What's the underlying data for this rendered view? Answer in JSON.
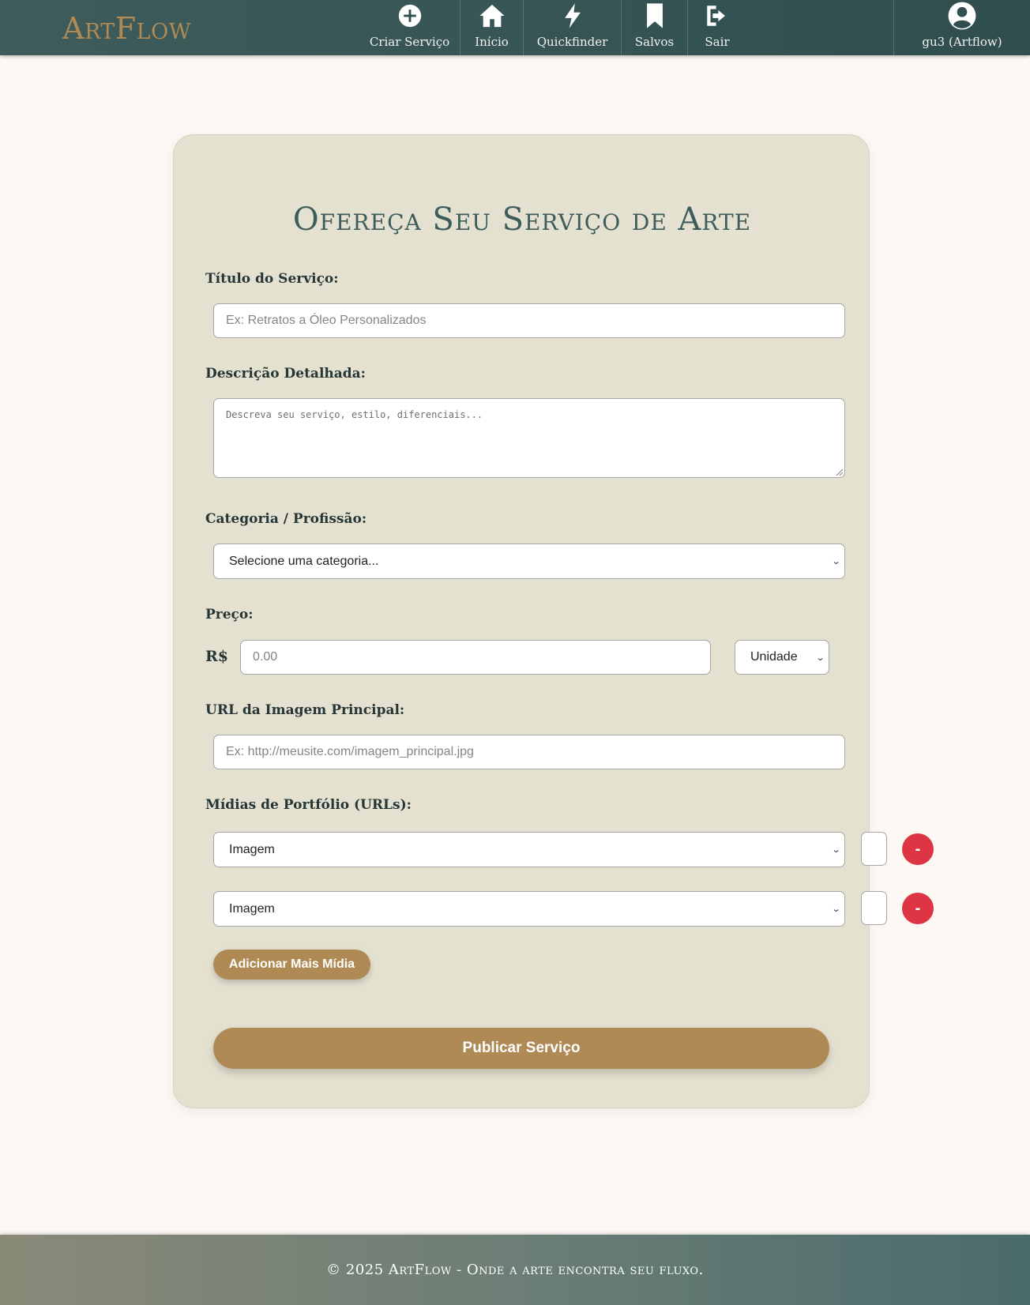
{
  "brand": {
    "logo": "ArtFlow",
    "accent_color": "#b08a55",
    "primary_color": "#3e5c5b"
  },
  "nav": {
    "items": [
      {
        "label": "Criar Serviço",
        "icon": "plus-circle-icon"
      },
      {
        "label": "Início",
        "icon": "home-icon"
      },
      {
        "label": "Quickfinder",
        "icon": "bolt-icon"
      },
      {
        "label": "Salvos",
        "icon": "bookmark-icon"
      },
      {
        "label": "Sair",
        "icon": "logout-icon"
      }
    ],
    "user": {
      "label": "gu3 (Artflow)",
      "icon": "user-circle-icon"
    }
  },
  "form": {
    "title": "Ofereça Seu Serviço de Arte",
    "titulo": {
      "label": "Título do Serviço:",
      "placeholder": "Ex: Retratos a Óleo Personalizados"
    },
    "descricao": {
      "label": "Descrição Detalhada:",
      "placeholder": "Descreva seu serviço, estilo, diferenciais..."
    },
    "categoria": {
      "label": "Categoria / Profissão:",
      "selected": "Selecione uma categoria..."
    },
    "preco": {
      "label": "Preço:",
      "currency": "R$",
      "placeholder": "0.00",
      "unit_selected": "Unidade"
    },
    "imagem_principal": {
      "label": "URL da Imagem Principal:",
      "placeholder": "Ex: http://meusite.com/imagem_principal.jpg"
    },
    "midias": {
      "label": "Mídias de Portfólio (URLs):",
      "rows": [
        {
          "type_selected": "Imagem",
          "remove_label": "-"
        },
        {
          "type_selected": "Imagem",
          "remove_label": "-"
        }
      ],
      "add_label": "Adicionar Mais Mídia"
    },
    "submit_label": "Publicar Serviço"
  },
  "footer": {
    "text": "© 2025 ArtFlow - Onde a arte encontra seu fluxo."
  }
}
